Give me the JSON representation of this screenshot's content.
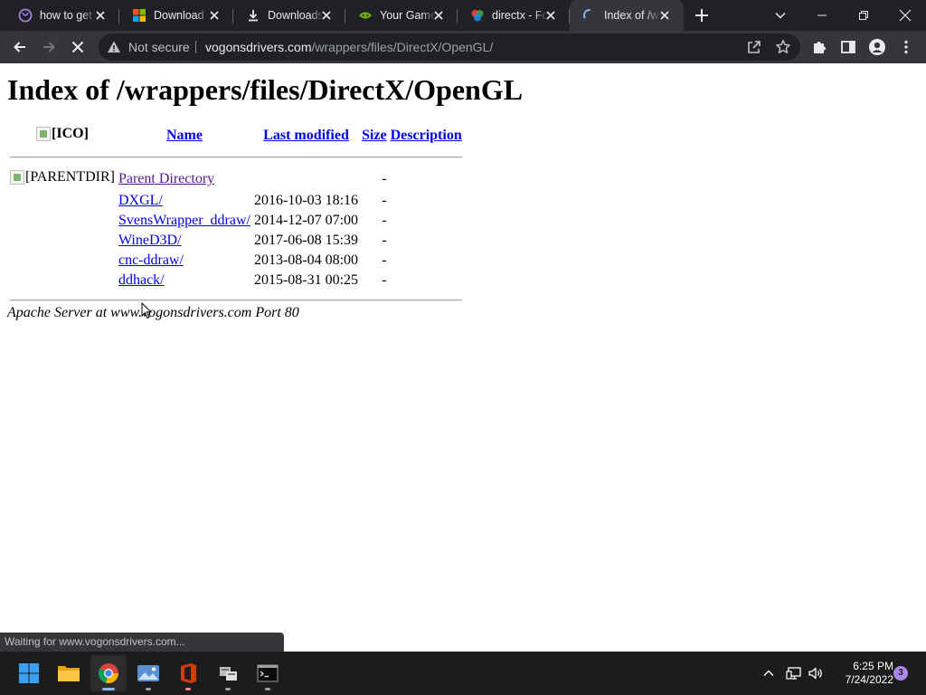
{
  "browser": {
    "tabs": [
      {
        "title": "how to get",
        "icon": "purple-search-favicon",
        "active": false
      },
      {
        "title": "Download",
        "icon": "microsoft-logo-icon",
        "active": false
      },
      {
        "title": "Downloads",
        "icon": "download-icon",
        "active": false
      },
      {
        "title": "Your Game",
        "icon": "nvidia-logo-icon",
        "active": false
      },
      {
        "title": "directx - Fo",
        "icon": "vogons-favicon",
        "active": false
      },
      {
        "title": "Index of /w",
        "icon": "loading-spinner-icon",
        "active": true
      }
    ],
    "security_label": "Not secure",
    "url_host": "vogonsdrivers.com",
    "url_path": "/wrappers/files/DirectX/OpenGL/"
  },
  "page": {
    "heading": "Index of /wrappers/files/DirectX/OpenGL",
    "columns": {
      "icon": "[ICO]",
      "name": "Name",
      "modified": "Last modified",
      "size": "Size",
      "description": "Description"
    },
    "rows": [
      {
        "icon_alt": "[PARENTDIR]",
        "name": "Parent Directory",
        "modified": "",
        "size": "-",
        "visited": true
      },
      {
        "icon_alt": "",
        "name": "DXGL/",
        "modified": "2016-10-03 18:16",
        "size": "-",
        "visited": false
      },
      {
        "icon_alt": "",
        "name": "SvensWrapper_ddraw/",
        "modified": "2014-12-07 07:00",
        "size": "-",
        "visited": false
      },
      {
        "icon_alt": "",
        "name": "WineD3D/",
        "modified": "2017-06-08 15:39",
        "size": "-",
        "visited": false
      },
      {
        "icon_alt": "",
        "name": "cnc-ddraw/",
        "modified": "2013-08-04 08:00",
        "size": "-",
        "visited": false
      },
      {
        "icon_alt": "",
        "name": "ddhack/",
        "modified": "2015-08-31 00:25",
        "size": "-",
        "visited": false
      }
    ],
    "server_signature": "Apache Server at www.vogonsdrivers.com Port 80"
  },
  "status_text": "Waiting for www.vogonsdrivers.com...",
  "taskbar": {
    "apps": [
      "windows-start-icon",
      "file-explorer-icon",
      "chrome-icon",
      "photos-icon",
      "office-icon",
      "network-drive-icon",
      "terminal-icon"
    ],
    "time": "6:25 PM",
    "date": "7/24/2022",
    "notification_count": "3"
  },
  "colors": {
    "tabstrip_bg": "#202124",
    "toolbar_bg": "#35363a",
    "link": "#0000ee",
    "visited_link": "#551a8b",
    "taskbar_bg": "#1c1c1c",
    "accent": "#8ab4f8"
  }
}
